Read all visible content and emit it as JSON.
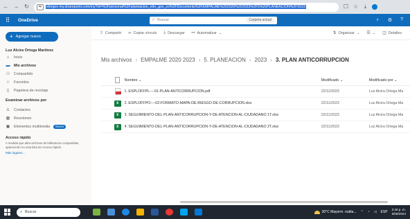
{
  "browser": {
    "url": "elergov-my.sharepoint.com/my?id=%2Fpersonal%2Fplaneacion_eler_gov_co%2FDocuments%2FEMPALME%202020%202023%2F5%20PLANEACION%2F2023",
    "site_info": "⇆"
  },
  "suite": {
    "app_name": "OneDrive",
    "search_placeholder": "Buscar",
    "search_scope": "Carpeta actual"
  },
  "nav": {
    "new_button": "Agregar nuevo",
    "user_name": "Luz Alcira Ortega Martínez",
    "items": [
      {
        "label": "Inicio"
      },
      {
        "label": "Mis archivos"
      },
      {
        "label": "Compartido"
      },
      {
        "label": "Favoritos"
      },
      {
        "label": "Papelera de reciclaje"
      }
    ],
    "browse_title": "Examinar archivos por",
    "browse_items": [
      {
        "label": "Contactos"
      },
      {
        "label": "Reuniones"
      },
      {
        "label": "Elementos multimedia"
      }
    ],
    "new_badge": "Nuevo",
    "quick_access_title": "Acceso rápido",
    "quick_access_desc": "A medida que abra archivos de bibliotecas compartidas, aparecerán en esta lista de Acceso rápido.",
    "more_places": "Más lugares..."
  },
  "commands": {
    "share": "Compartir",
    "copy_link": "Copiar vínculo",
    "download": "Descargar",
    "automate": "Automatizar",
    "sort": "Organizar",
    "view": "",
    "details": "Detalles"
  },
  "breadcrumb": {
    "items": [
      "Mis archivos",
      "EMPALME 2020 2023",
      "5. PLANEACION",
      "2023"
    ],
    "current": "3. PLAN ANTICORRUPCION"
  },
  "table": {
    "headers": {
      "name": "Nombre",
      "modified": "Modificado",
      "modified_by": "Modificado por"
    },
    "rows": [
      {
        "name": "1. ESPLOFFPL----01-PLAN-ANTICORRUPCION.pdf",
        "type": "pdf",
        "modified": "22/11/2023",
        "modified_by": "Luz Alcira Ortega Ma"
      },
      {
        "name": "2. ESPLOFFPO----02-FORMATO-MAPA-DE-RIESGO-DE-CORRUPCION.xlsx",
        "type": "xlsx",
        "modified": "22/11/2023",
        "modified_by": "Luz Alcira Ortega Ma"
      },
      {
        "name": "3. SEGUIMIENTO-DEL-PLAN-ANTICORRUPCION-Y-DE-ATENCION-AL-CIUDADANO 1T.xlsx",
        "type": "xlsx",
        "modified": "22/11/2023",
        "modified_by": "Luz Alcira Ortega Ma"
      },
      {
        "name": "4. SEGUIMIENTO-DEL-PLAN-ANTICORRUPCION-Y-DE-ATENCION-AL-CIUDADANO 2T.xlsx",
        "type": "xlsx",
        "modified": "22/11/2023",
        "modified_by": "Luz Alcira Ortega Ma"
      }
    ]
  },
  "taskbar": {
    "search_placeholder": "Buscar",
    "weather": "30°C Mayorm. nubla...",
    "lang": "ESP",
    "time": "2:40 p. m.",
    "date": "5/08/2024"
  }
}
